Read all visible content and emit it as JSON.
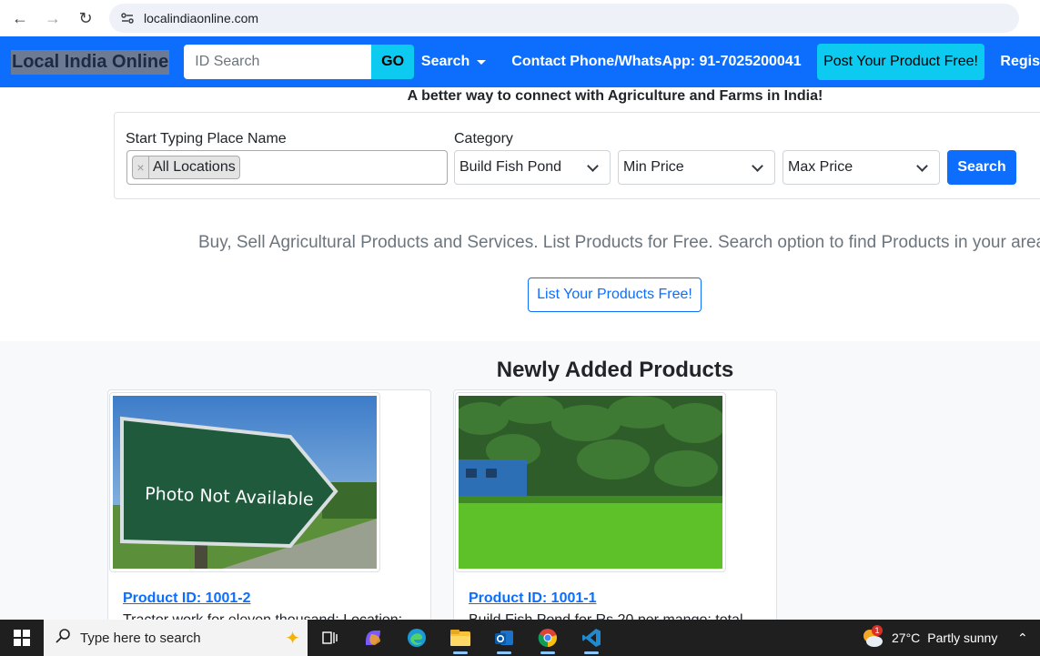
{
  "browser": {
    "url": "localindiaonline.com"
  },
  "navbar": {
    "brand": "Local India Online",
    "id_search_placeholder": "ID Search",
    "go_label": "GO",
    "search_label": "Search",
    "contact": "Contact Phone/WhatsApp: 91-7025200041",
    "post_label": "Post Your Product Free!",
    "register_label": "Regis"
  },
  "tagline": "A better way to connect with Agriculture and Farms in India!",
  "filters": {
    "place_label": "Start Typing Place Name",
    "place_tag": "All Locations",
    "place_tag_remove": "×",
    "category_label": "Category",
    "category_value": "Build Fish Pond",
    "min_price": "Min Price",
    "max_price": "Max Price",
    "search_label": "Search"
  },
  "lead": "Buy, Sell Agricultural Products and Services. List Products for Free. Search option to find Products in your area.",
  "list_button": "List Your Products Free!",
  "products": {
    "title": "Newly Added Products",
    "items": [
      {
        "image_text": "Photo Not Available",
        "link": "Product ID: 1001-2",
        "desc": "Tractor work for eleven thousand; Location:"
      },
      {
        "link": "Product ID: 1001-1",
        "desc": "Build Fish Pond for Rs 20 per mango; total"
      }
    ]
  },
  "taskbar": {
    "search_placeholder": "Type here to search",
    "temperature": "27°C",
    "condition": "Partly sunny",
    "weather_badge": "1",
    "icons": [
      "windows-logo-icon",
      "search-icon",
      "task-view-icon",
      "copilot-icon",
      "edge-icon",
      "file-explorer-icon",
      "outlook-icon",
      "chrome-icon",
      "vscode-icon"
    ]
  },
  "colors": {
    "primary": "#0d6efd",
    "info": "#0dcaf0",
    "taskbar": "#1f1f1f"
  }
}
